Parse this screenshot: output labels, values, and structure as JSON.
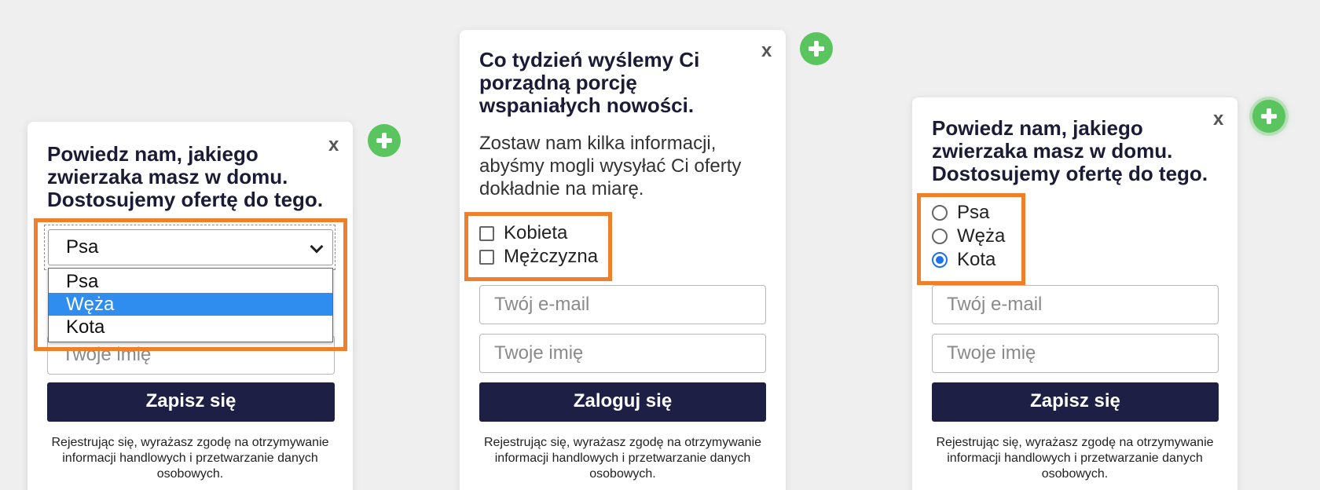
{
  "close_label": "x",
  "card1": {
    "title_lines": [
      "Powiedz nam, jakiego",
      "zwierzaka masz w domu.",
      "Dostosujemy ofertę do tego."
    ],
    "select_value": "Psa",
    "options": [
      "Psa",
      "Węża",
      "Kota"
    ],
    "name_placeholder": "Twoje imię",
    "button_label": "Zapisz się",
    "legal_lines": [
      "Rejestrując się, wyrażasz zgodę na otrzymywanie",
      "informacji handlowych i przetwarzanie danych",
      "osobowych."
    ]
  },
  "card2": {
    "title_lines": [
      "Co tydzień wyślemy Ci",
      "porządną porcję",
      "wspaniałych nowości."
    ],
    "desc_lines": [
      "Zostaw nam kilka informacji,",
      "abyśmy mogli wysyłać Ci oferty",
      "dokładnie na miarę."
    ],
    "checkboxes": [
      "Kobieta",
      "Mężczyzna"
    ],
    "email_placeholder": "Twój e-mail",
    "name_placeholder": "Twoje imię",
    "button_label": "Zaloguj się",
    "legal_lines": [
      "Rejestrując się, wyrażasz zgodę na otrzymywanie",
      "informacji handlowych i przetwarzanie danych",
      "osobowych."
    ]
  },
  "card3": {
    "title_lines": [
      "Powiedz nam, jakiego",
      "zwierzaka masz w domu.",
      "Dostosujemy ofertę do tego."
    ],
    "radios": [
      "Psa",
      "Węża",
      "Kota"
    ],
    "selected_radio": "Kota",
    "email_placeholder": "Twój e-mail",
    "name_placeholder": "Twoje imię",
    "button_label": "Zapisz się",
    "legal_lines": [
      "Rejestrując się, wyrażasz zgodę na otrzymywanie",
      "informacji handlowych i przetwarzanie danych",
      "osobowych."
    ]
  },
  "colors": {
    "highlight": "#f07f2b",
    "button": "#1e1f45",
    "add": "#5ac55e",
    "option_selected": "#2f8df0",
    "radio_checked": "#1a73e8"
  },
  "icons": [
    "close-icon",
    "add-icon",
    "chevron-down-icon"
  ]
}
